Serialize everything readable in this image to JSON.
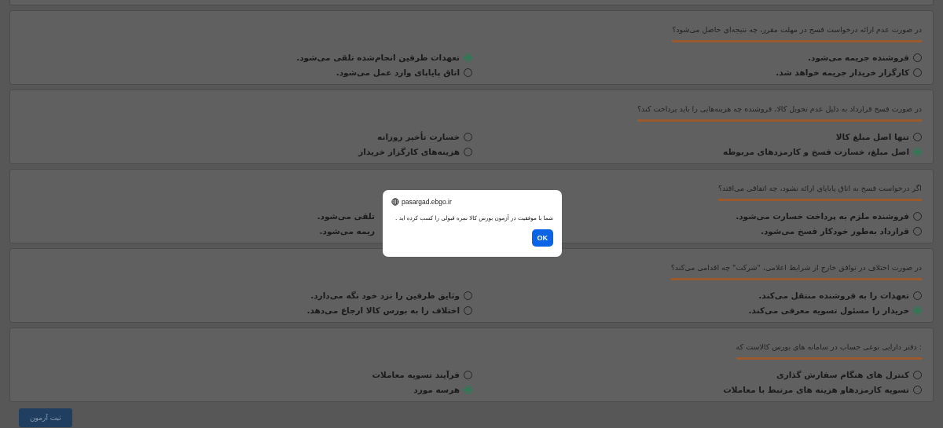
{
  "questions": [
    {
      "text": "در صورت عدم ارائه درخواست فسخ در مهلت مقرر، چه نتیجه‌ای حاصل می‌شود؟",
      "options": [
        {
          "kind": "radio",
          "label": "فروشنده جریمه می‌شود.",
          "selected": false
        },
        {
          "kind": "radio",
          "label": "تعهدات طرفین انجام‌شده تلقی می‌شود.",
          "selected": true
        },
        {
          "kind": "radio",
          "label": "کارگزار خریدار جریمه خواهد شد.",
          "selected": false
        },
        {
          "kind": "radio",
          "label": "اتاق پایاپای وارد عمل می‌شود.",
          "selected": false
        }
      ]
    },
    {
      "text": "در صورت فسخ قرارداد به دلیل عدم تحویل کالا، فروشنده چه هزینه‌هایی را باید پرداخت کند؟",
      "options": [
        {
          "kind": "radio",
          "label": "تنها اصل مبلغ کالا",
          "selected": false
        },
        {
          "kind": "radio",
          "label": "خسارت تأخیر روزانه",
          "selected": false
        },
        {
          "kind": "radio",
          "label": "اصل مبلغ، خسارت فسخ و کارمزدهای مربوطه",
          "selected": true
        },
        {
          "kind": "radio",
          "label": "هزینه‌های کارگزار خریدار",
          "selected": false
        }
      ]
    },
    {
      "text": "اگر درخواست فسخ به اتاق پایاپای ارائه نشود، چه اتفاقی می‌افتد؟",
      "options": [
        {
          "kind": "radio",
          "label": "فروشنده ملزم به پرداخت خسارت می‌شود.",
          "selected": false
        },
        {
          "kind": "partial",
          "label": "تلقی می‌شود."
        },
        {
          "kind": "radio",
          "label": "قرارداد به‌طور خودکار فسخ می‌شود.",
          "selected": false
        },
        {
          "kind": "partial",
          "label": "ریمه می‌شود."
        }
      ]
    },
    {
      "text": "در صورت اختلاف در توافق خارج از شرایط اعلامی، \"شرکت\" چه اقدامی می‌کند؟",
      "options": [
        {
          "kind": "radio",
          "label": "تعهدات را به فروشنده منتقل می‌کند.",
          "selected": false
        },
        {
          "kind": "radio",
          "label": "وثایق طرفین را نزد خود نگه می‌دارد.",
          "selected": false
        },
        {
          "kind": "radio",
          "label": "خریدار را مسئول تسویه معرفی می‌کند.",
          "selected": true
        },
        {
          "kind": "radio",
          "label": "اختلاف را به بورس کالا ارجاع می‌دهد.",
          "selected": false
        }
      ]
    },
    {
      "text": ": دفتر دارایی نوعی حساب در سامانه های بورس کالاست که",
      "options": [
        {
          "kind": "radio",
          "label": "کنترل های هنگام سفارش گذاری",
          "selected": false
        },
        {
          "kind": "radio",
          "label": "فرآیند تسویه معاملات",
          "selected": false
        },
        {
          "kind": "radio",
          "label": "تسویه کارمزدهاو هزینه های مرتبط با معاملات",
          "selected": false
        },
        {
          "kind": "radio",
          "label": "هرسه مورد",
          "selected": true
        }
      ]
    }
  ],
  "submit_button": "ثبت آزمون",
  "dialog": {
    "site": "pasargad.ebgo.ir",
    "message": "شما با موفقیت در آزمون بورس کالا نمره قبولی را کسب کرده اید .",
    "button": "OK"
  }
}
